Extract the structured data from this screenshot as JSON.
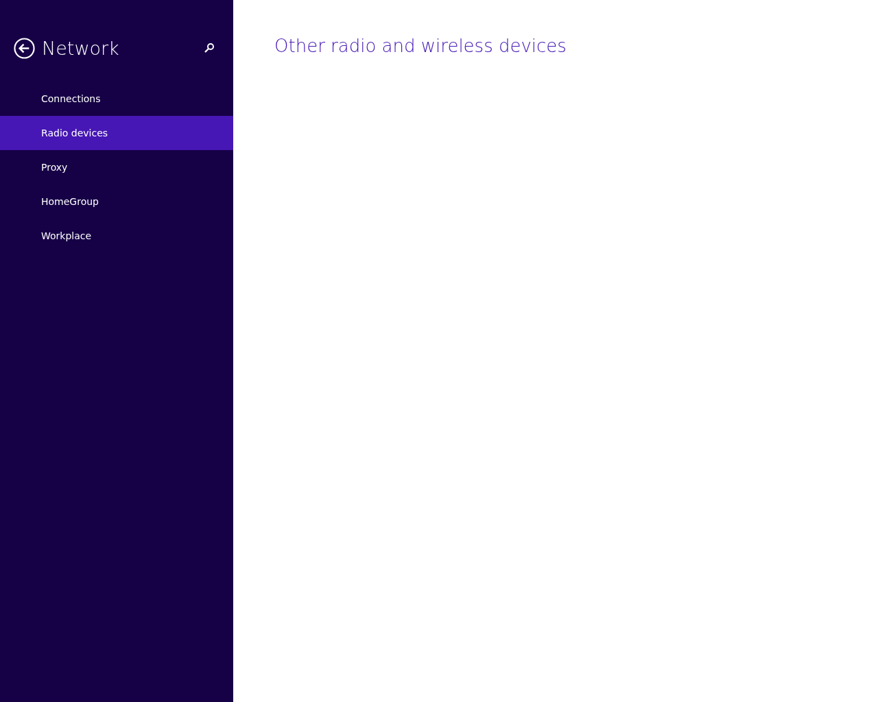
{
  "sidebar": {
    "title": "Network",
    "items": [
      {
        "label": "Connections",
        "selected": false
      },
      {
        "label": "Radio devices",
        "selected": true
      },
      {
        "label": "Proxy",
        "selected": false
      },
      {
        "label": "HomeGroup",
        "selected": false
      },
      {
        "label": "Workplace",
        "selected": false
      }
    ]
  },
  "main": {
    "heading": "Other radio and wireless devices"
  }
}
